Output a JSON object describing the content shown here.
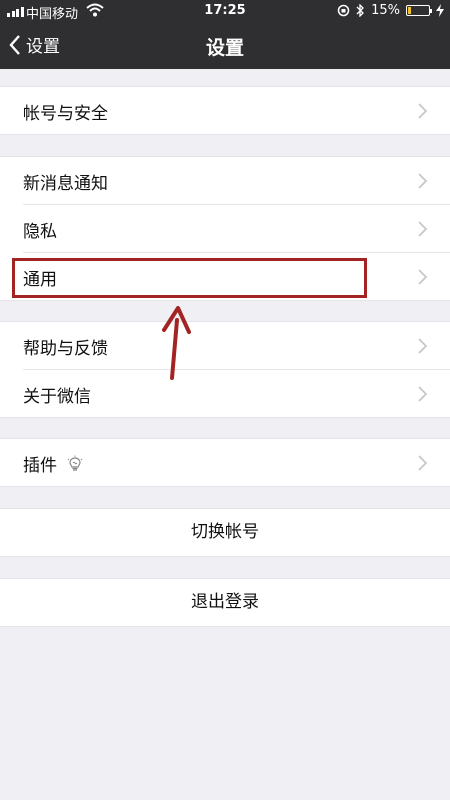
{
  "status_bar": {
    "carrier": "中国移动",
    "time": "17:25",
    "battery": "15%",
    "battery_level": 0.15
  },
  "nav": {
    "back_label": "设置",
    "title": "设置"
  },
  "groups": [
    {
      "items": [
        {
          "label": "帐号与安全"
        }
      ]
    },
    {
      "items": [
        {
          "label": "新消息通知"
        },
        {
          "label": "隐私"
        },
        {
          "label": "通用"
        }
      ]
    },
    {
      "items": [
        {
          "label": "帮助与反馈"
        },
        {
          "label": "关于微信"
        }
      ]
    },
    {
      "items": [
        {
          "label": "插件"
        }
      ]
    }
  ],
  "actions": {
    "switch_account": "切换帐号",
    "logout": "退出登录"
  },
  "annotation": {
    "color": "#a22523",
    "highlighted_item": "通用"
  },
  "icons": [
    "signal-icon",
    "wifi-icon",
    "orientation-lock-icon",
    "bluetooth-icon",
    "battery-icon",
    "charging-icon",
    "back-chevron-icon",
    "chevron-right-icon",
    "lightbulb-icon",
    "arrow-icon"
  ]
}
